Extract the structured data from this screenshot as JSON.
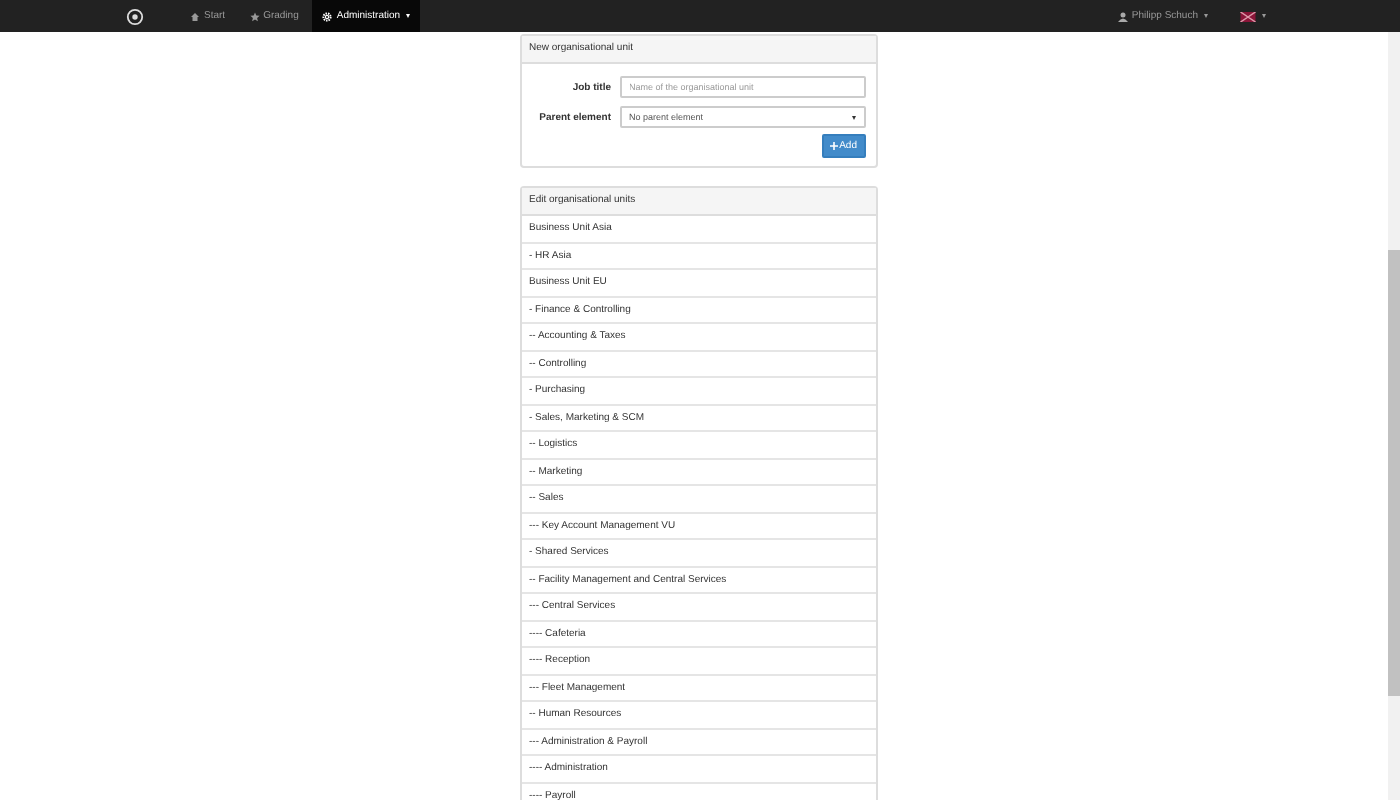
{
  "navbar": {
    "items": [
      {
        "label": "Start",
        "selected": false,
        "dropdown": false
      },
      {
        "label": "Grading",
        "selected": false,
        "dropdown": false
      },
      {
        "label": "Administration",
        "selected": true,
        "dropdown": true
      }
    ],
    "user": {
      "label": "Philipp Schuch"
    }
  },
  "new_unit_panel": {
    "title": "New organisational unit",
    "job_title": {
      "label": "Job title",
      "placeholder": "Name of the organisational unit"
    },
    "parent_element": {
      "label": "Parent element",
      "value": "No parent element"
    },
    "add_button": {
      "label": "Add"
    }
  },
  "edit_units_panel": {
    "title": "Edit organisational units",
    "items": [
      {
        "label": "Business Unit Asia"
      },
      {
        "label": "- HR Asia"
      },
      {
        "label": "Business Unit EU"
      },
      {
        "label": "- Finance & Controlling"
      },
      {
        "label": "-- Accounting & Taxes"
      },
      {
        "label": "-- Controlling"
      },
      {
        "label": "- Purchasing"
      },
      {
        "label": "- Sales, Marketing & SCM"
      },
      {
        "label": "-- Logistics"
      },
      {
        "label": "-- Marketing"
      },
      {
        "label": "-- Sales"
      },
      {
        "label": "--- Key Account Management VU"
      },
      {
        "label": "- Shared Services"
      },
      {
        "label": "-- Facility Management and Central Services"
      },
      {
        "label": "--- Central Services"
      },
      {
        "label": "---- Cafeteria"
      },
      {
        "label": "---- Reception"
      },
      {
        "label": "--- Fleet Management"
      },
      {
        "label": "-- Human Resources"
      },
      {
        "label": "--- Administration & Payroll"
      },
      {
        "label": "---- Administration"
      },
      {
        "label": "---- Payroll"
      }
    ]
  }
}
